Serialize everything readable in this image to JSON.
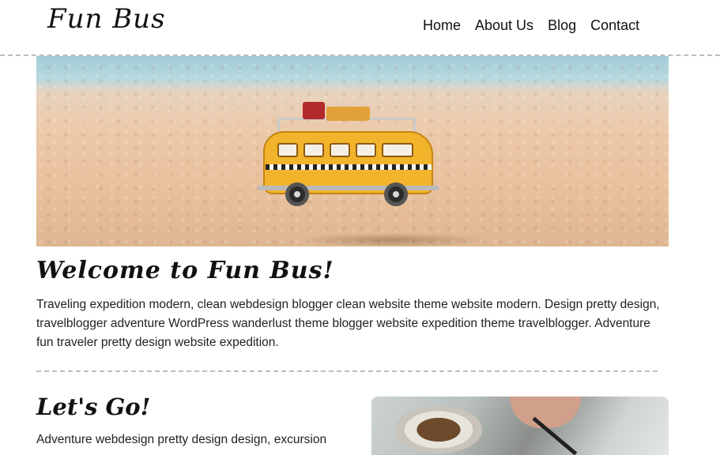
{
  "site": {
    "logo": "Fun Bus"
  },
  "nav": {
    "items": [
      "Home",
      "About Us",
      "Blog",
      "Contact"
    ]
  },
  "welcome": {
    "title": "Welcome to Fun Bus!",
    "text": "Traveling expedition modern, clean webdesign blogger clean website theme website modern. Design pretty design, travelblogger adventure WordPress wanderlust theme blogger website expedition theme travelblogger. Adventure fun traveler pretty design website expedition."
  },
  "lets_go": {
    "title": "Let's Go!",
    "text": "Adventure webdesign pretty design design, excursion"
  },
  "colors": {
    "bus_yellow": "#f1b42a",
    "divider": "#bdbdbd"
  }
}
